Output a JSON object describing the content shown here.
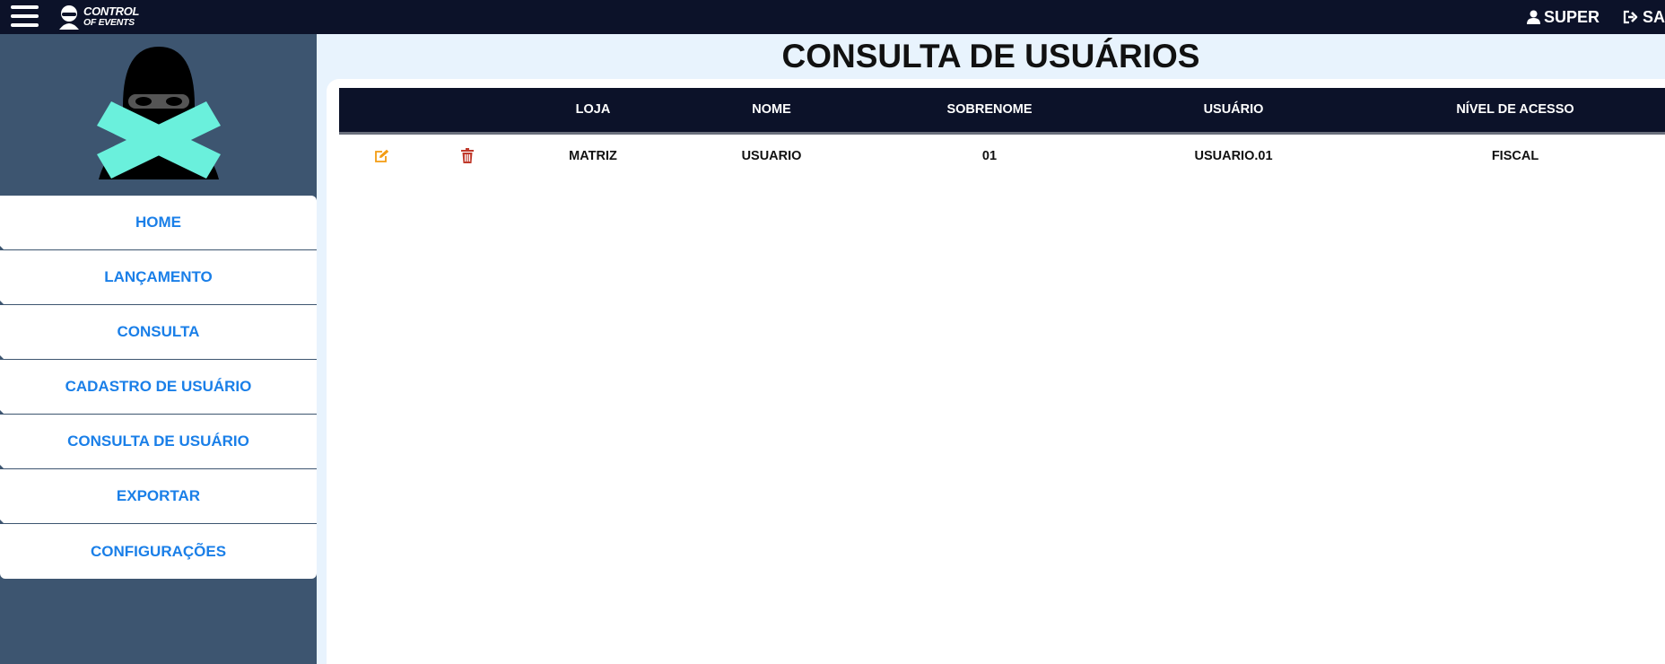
{
  "topbar": {
    "brand_line1": "CONTROL",
    "brand_line2": "OF EVENTS",
    "user_label": "SUPER",
    "logout_label": "SA"
  },
  "sidebar": {
    "items": [
      {
        "label": "HOME"
      },
      {
        "label": "LANÇAMENTO"
      },
      {
        "label": "CONSULTA"
      },
      {
        "label": "CADASTRO DE USUÁRIO"
      },
      {
        "label": "CONSULTA DE USUÁRIO"
      },
      {
        "label": "EXPORTAR"
      },
      {
        "label": "CONFIGURAÇÕES"
      }
    ]
  },
  "main": {
    "title": "CONSULTA DE USUÁRIOS",
    "table": {
      "columns": [
        "LOJA",
        "NOME",
        "SOBRENOME",
        "USUÁRIO",
        "NÍVEL DE ACESSO"
      ],
      "rows": [
        {
          "loja": "MATRIZ",
          "nome": "USUARIO",
          "sobrenome": "01",
          "usuario": "USUARIO.01",
          "nivel": "FISCAL"
        }
      ]
    }
  },
  "colors": {
    "topbar_bg": "#0c1229",
    "sidebar_bg": "#3d5570",
    "menu_text": "#1a7fe8",
    "accent_x": "#6af0dc",
    "edit_icon": "#f39c12",
    "delete_icon": "#c0392b"
  },
  "icons": {
    "menu": "hamburger-icon",
    "user": "user-icon",
    "logout": "logout-icon",
    "edit": "edit-icon",
    "delete": "trash-icon"
  }
}
